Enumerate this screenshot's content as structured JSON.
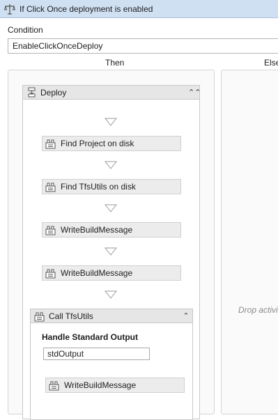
{
  "title_bar": {
    "title": "If Click Once deployment is enabled",
    "icon": "if-activity-icon"
  },
  "condition": {
    "label": "Condition",
    "value": "EnableClickOnceDeploy"
  },
  "branches": {
    "then_label": "Then",
    "else_label": "Else",
    "else_drop_text": "Drop activi"
  },
  "sequence": {
    "title": "Deploy",
    "icon": "sequence-icon",
    "activities": [
      {
        "label": "Find Project on disk",
        "icon": "activity-icon"
      },
      {
        "label": "Find TfsUtils on disk",
        "icon": "activity-icon"
      },
      {
        "label": "WriteBuildMessage",
        "icon": "activity-icon"
      },
      {
        "label": "WriteBuildMessage",
        "icon": "activity-icon"
      }
    ]
  },
  "call": {
    "title": "Call TfsUtils",
    "section_label": "Handle Standard Output",
    "std_output_value": "stdOutput",
    "inner_activity": "WriteBuildMessage"
  },
  "colors": {
    "title_bar": "#cfe0f3",
    "activity_bg": "#ececec",
    "header_bg": "#e6e6e6"
  }
}
